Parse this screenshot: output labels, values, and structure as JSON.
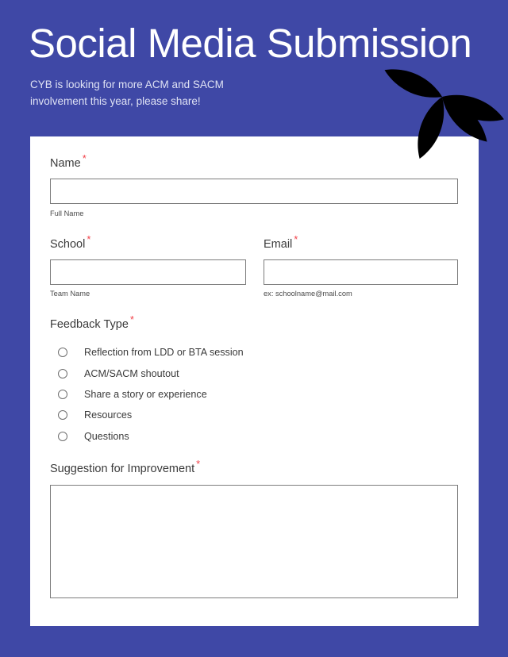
{
  "header": {
    "title": "Social Media Submission",
    "subtitle": "CYB is looking for more ACM and SACM involvement this year, please share!",
    "decoration_icon": "four-petal-flower-icon",
    "background_color": "#3f48a6",
    "title_color": "#ffffff",
    "subtitle_color": "#dfe2f4"
  },
  "form": {
    "required_marker": "*",
    "required_marker_color": "#f2434b",
    "card_background": "#ffffff",
    "fields": {
      "name": {
        "label": "Name",
        "required": true,
        "value": "",
        "placeholder": "",
        "helper": "Full Name"
      },
      "school": {
        "label": "School",
        "required": true,
        "value": "",
        "placeholder": "",
        "helper": "Team Name"
      },
      "email": {
        "label": "Email",
        "required": true,
        "value": "",
        "placeholder": "",
        "helper": "ex: schoolname@mail.com"
      },
      "feedback_type": {
        "label": "Feedback Type",
        "required": true,
        "selected": null,
        "options": [
          "Reflection from LDD or BTA session",
          "ACM/SACM shoutout",
          "Share a story or experience",
          "Resources",
          "Questions"
        ]
      },
      "suggestion": {
        "label": "Suggestion for Improvement",
        "required": true,
        "value": "",
        "placeholder": ""
      }
    }
  }
}
